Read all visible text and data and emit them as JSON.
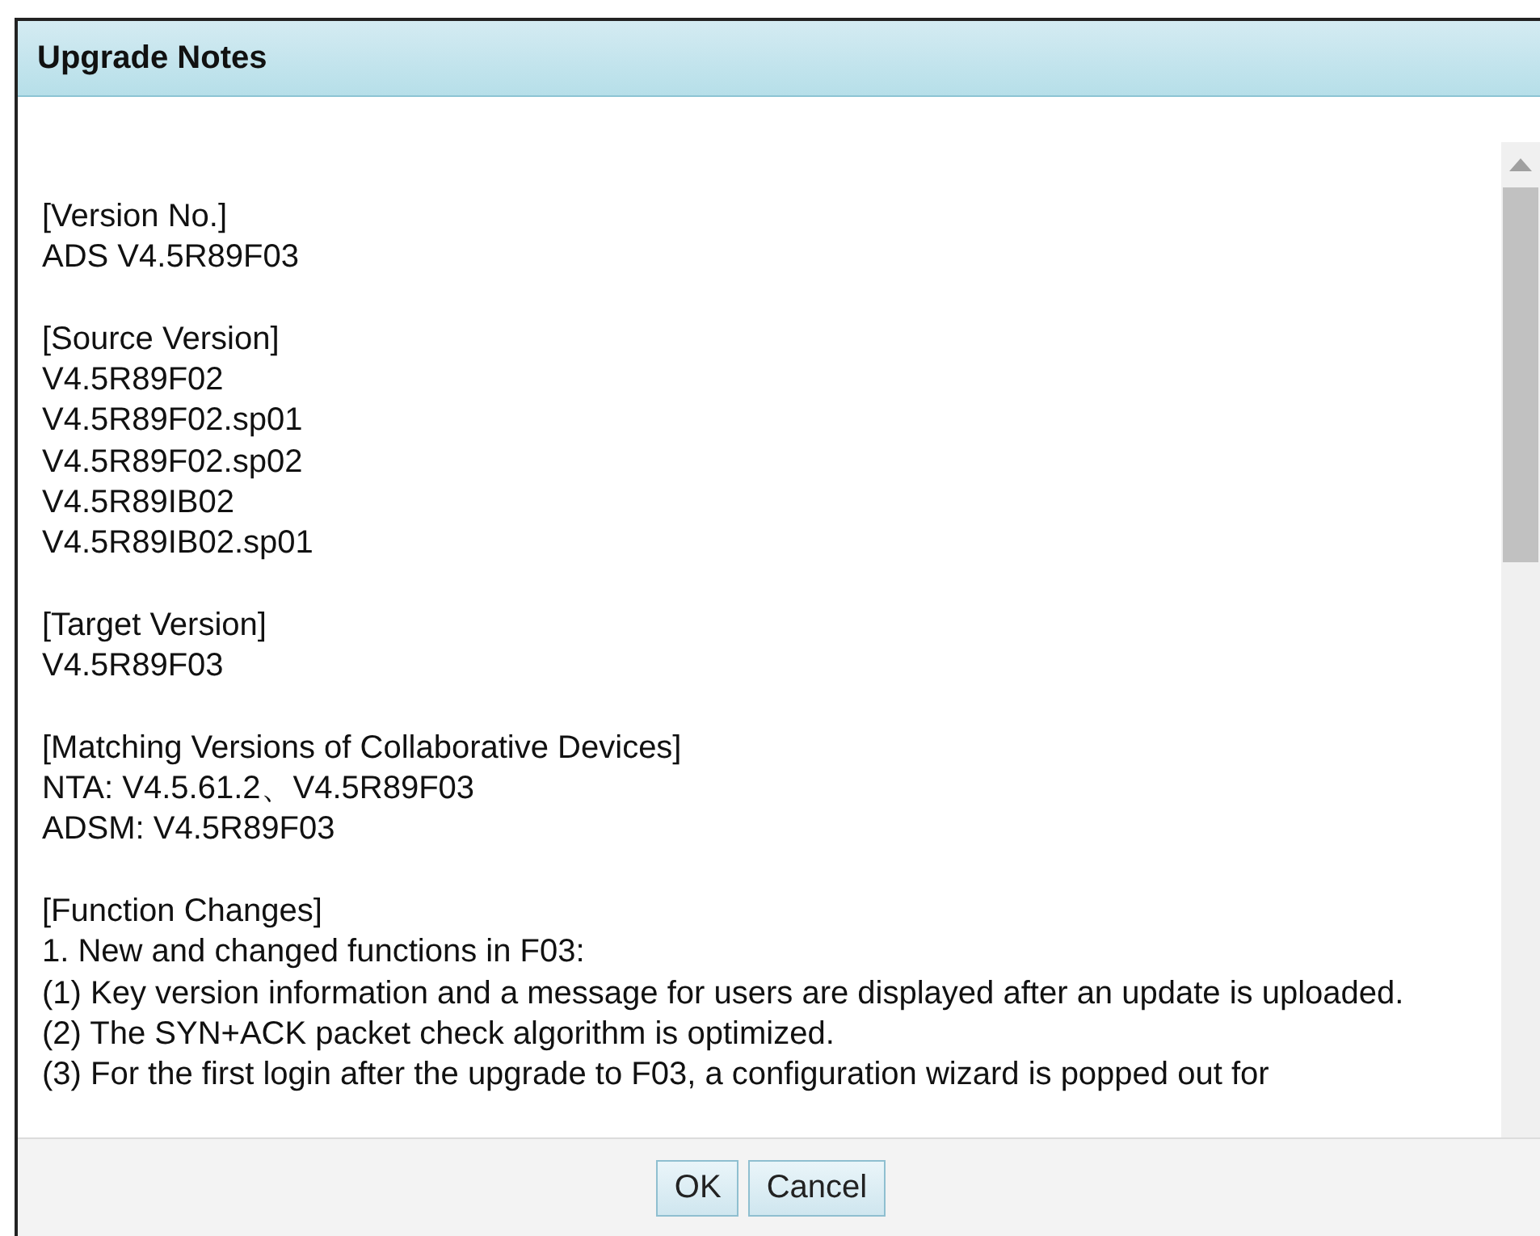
{
  "window": {
    "title": "Upgrade Notes"
  },
  "sections": [
    {
      "heading": "[Version No.]",
      "lines": [
        "ADS V4.5R89F03"
      ]
    },
    {
      "heading": "[Source Version]",
      "lines": [
        "V4.5R89F02",
        "V4.5R89F02.sp01",
        "V4.5R89F02.sp02",
        "V4.5R89IB02",
        "V4.5R89IB02.sp01"
      ]
    },
    {
      "heading": "[Target Version]",
      "lines": [
        "V4.5R89F03"
      ]
    },
    {
      "heading": "[Matching Versions of Collaborative Devices]",
      "lines": [
        "NTA: V4.5.61.2、V4.5R89F03",
        "ADSM: V4.5R89F03"
      ]
    },
    {
      "heading": "[Function Changes]",
      "lines": [
        "1. New and changed functions in F03:",
        "(1) Key version information and a message for users are displayed after an update is uploaded.",
        "(2) The SYN+ACK packet check algorithm is optimized.",
        "(3) For the first login after the upgrade to F03, a configuration wizard is popped out for"
      ]
    }
  ],
  "buttons": [
    "OK",
    "Cancel"
  ]
}
